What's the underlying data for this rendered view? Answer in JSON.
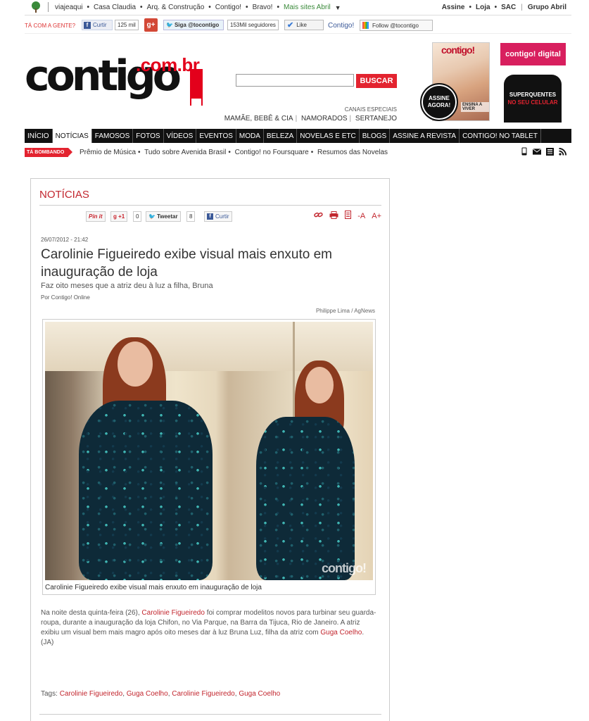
{
  "topbar": {
    "links": [
      "viajeaqui",
      "Casa Claudia",
      "Arq. & Construção",
      "Contigo!",
      "Bravo!"
    ],
    "more": "Mais sites Abril",
    "right": [
      "Assine",
      "Loja",
      "SAC"
    ],
    "group": "Grupo Abril"
  },
  "social": {
    "tacom": "TÁ COM A GENTE?",
    "fb_curtir": "Curtir",
    "fb_count": "125 mil",
    "gplus": "g+",
    "twitter_follow": "Siga @tocontigo",
    "twitter_count": "153Mil seguidores",
    "like": "Like",
    "fb_page": "Contigo!",
    "follow": "Follow @tocontigo"
  },
  "header": {
    "logo_word": "contigo",
    "logo_domain": ".com.br",
    "search_placeholder": "",
    "search_button": "BUSCAR",
    "canais_label": "CANAIS ESPECIAIS",
    "canais": [
      "MAMÃE, BEBÊ & CIA",
      "NAMORADOS",
      "SERTANEJO"
    ],
    "magazine_title": "contigo!",
    "magazine_tag": "ENSINA A VIVER",
    "assine_badge": "ASSINE AGORA!",
    "digital": "contigo! digital",
    "phone_line1": "SUPERQUENTES",
    "phone_line2": "NO SEU CELULAR"
  },
  "nav": {
    "items": [
      "INÍCIO",
      "NOTÍCIAS",
      "FAMOSOS",
      "FOTOS",
      "VÍDEOS",
      "EVENTOS",
      "MODA",
      "BELEZA",
      "NOVELAS E ETC",
      "BLOGS",
      "ASSINE A REVISTA",
      "CONTIGO! NO TABLET"
    ],
    "active": "NOTÍCIAS"
  },
  "trending": {
    "tag": "TÁ BOMBANDO",
    "links": [
      "Prêmio de Música",
      "Tudo sobre Avenida Brasil",
      "Contigo! no Foursquare",
      "Resumos das Novelas"
    ]
  },
  "article": {
    "section": "NOTÍCIAS",
    "share": {
      "pinit": "Pin it",
      "gplus": "+1",
      "gplus_count": "0",
      "tweet": "Tweetar",
      "tweet_count": "8",
      "fb": "Curtir"
    },
    "font_minus": "-A",
    "font_plus": "A+",
    "date": "26/07/2012 - 21:42",
    "title": "Carolinie Figueiredo exibe visual mais enxuto em inauguração de loja",
    "subtitle": "Faz oito meses que a atriz deu à luz a filha, Bruna",
    "byline": "Por Contigo! Online",
    "photo_credit": "Philippe Lima / AgNews",
    "photo_watermark": "contigo!",
    "photo_caption": "Carolinie Figueiredo exibe visual mais enxuto em inauguração de loja",
    "body_1": "Na noite desta quinta-feira (26), ",
    "body_link1": "Carolinie Figueiredo",
    "body_2": " foi comprar modelitos novos para turbinar seu guarda-roupa, durante a inauguração da loja Chifon, no Via Parque, na Barra da Tijuca, Rio de Janeiro. A atriz exibiu um visual bem mais magro após oito meses dar à luz Bruna Luz, filha da atriz com ",
    "body_link2": "Guga Coelho",
    "body_3": ". (JA)",
    "tags_label": "Tags:",
    "tags": [
      "Carolinie Figueiredo",
      "Guga Coelho",
      "Carolinie Figueiredo",
      "Guga Coelho"
    ]
  }
}
